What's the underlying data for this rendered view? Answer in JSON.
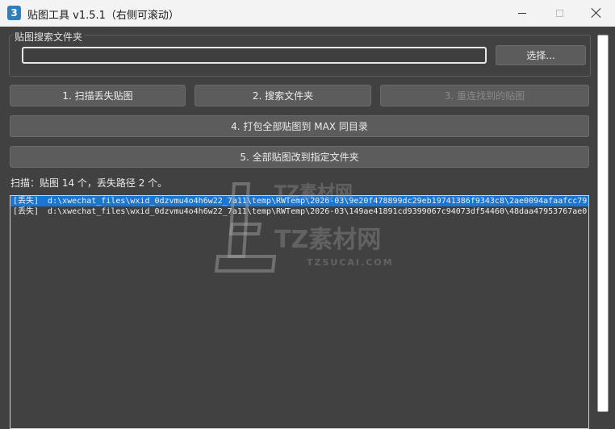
{
  "window": {
    "icon_label": "3",
    "title": "贴图工具 v1.5.1（右侧可滚动）",
    "controls": [
      "minimize",
      "maximize",
      "close"
    ]
  },
  "search": {
    "group_title": "贴图搜索文件夹",
    "path_value": "",
    "browse_label": "选择..."
  },
  "buttons": {
    "scan_missing": "1. 扫描丢失贴图",
    "search_folder": "2. 搜索文件夹",
    "relink_found": "3. 重连找到的贴图",
    "pack_textures": "4. 打包全部贴图到 MAX 同目录",
    "change_all": "5. 全部贴图改到指定文件夹"
  },
  "status": {
    "text": "扫描：贴图 14 个，丢失路径 2 个。"
  },
  "missing_list": [
    {
      "tag": "[丢失]",
      "path": "d:\\xwechat_files\\wxid_0dzvmu4o4h6w22_7a11\\temp\\RWTemp\\2026-03\\9e20f478899dc29eb19741386f9343c8\\2ae0094afaafcc79"
    },
    {
      "tag": "[丢失]",
      "path": "d:\\xwechat_files\\wxid_0dzvmu4o4h6w22_7a11\\temp\\RWTemp\\2026-03\\149ae41891cd9399067c94073df54460\\48daa47953767ae0"
    }
  ],
  "watermark": {
    "brand_top": "TZ素材网",
    "brand_main": "TZ素材网",
    "domain": "TZSUCAI.COM"
  },
  "colors": {
    "accent": "#1976d2",
    "client_bg": "#414141",
    "button_bg": "#5c5c5c",
    "titlebar_bg": "#f3f3f3"
  },
  "icons": {
    "app": "app-icon",
    "minimize": "minimize-icon",
    "maximize": "maximize-icon",
    "close": "close-icon"
  }
}
